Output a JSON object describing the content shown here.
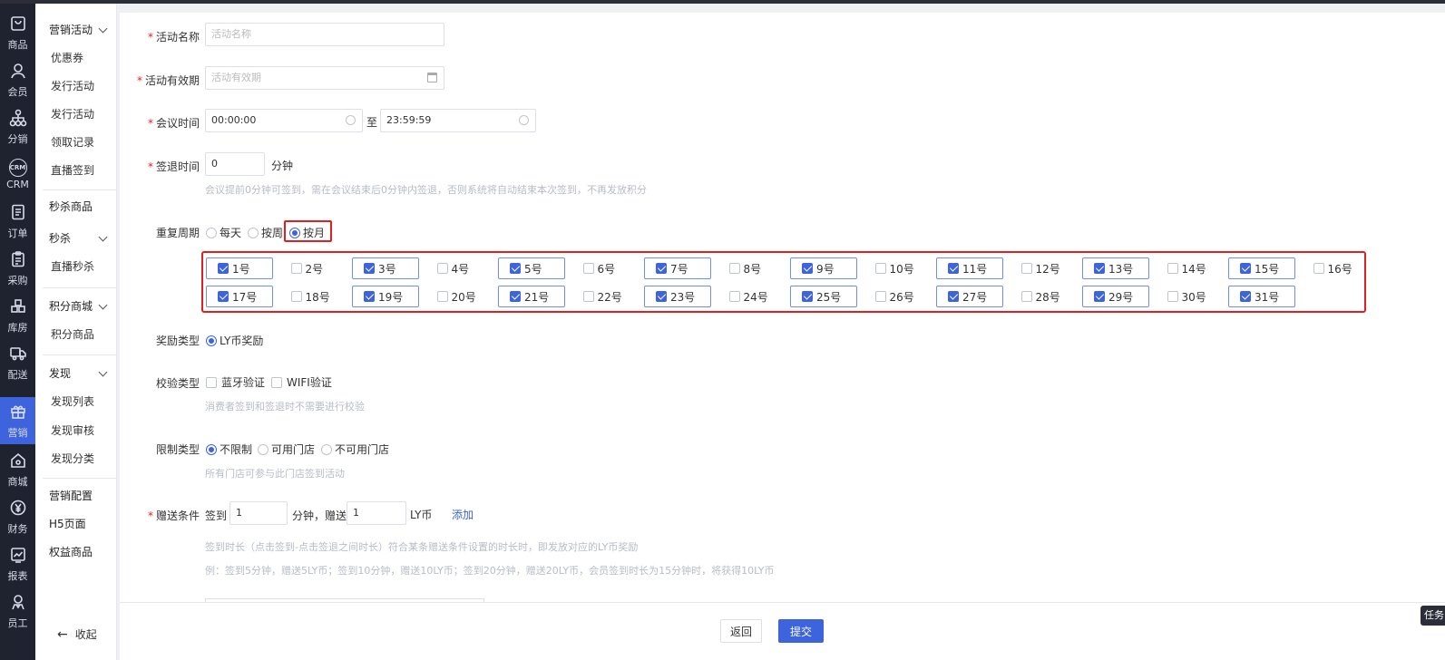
{
  "rail": [
    {
      "key": "goods",
      "label": "商品",
      "icon": "bag-icon"
    },
    {
      "key": "member",
      "label": "会员",
      "icon": "user-icon"
    },
    {
      "key": "distribution",
      "label": "分销",
      "icon": "network-icon"
    },
    {
      "key": "crm",
      "label": "CRM",
      "icon": "crm-icon"
    },
    {
      "key": "orders",
      "label": "订单",
      "icon": "document-icon"
    },
    {
      "key": "purchase",
      "label": "采购",
      "icon": "clipboard-icon"
    },
    {
      "key": "warehouse",
      "label": "库房",
      "icon": "boxes-icon"
    },
    {
      "key": "delivery",
      "label": "配送",
      "icon": "truck-icon"
    },
    {
      "key": "marketing",
      "label": "营销",
      "icon": "gift-icon"
    },
    {
      "key": "mall",
      "label": "商城",
      "icon": "home-icon"
    },
    {
      "key": "finance",
      "label": "财务",
      "icon": "yen-icon"
    },
    {
      "key": "reports",
      "label": "报表",
      "icon": "chart-icon"
    },
    {
      "key": "staff",
      "label": "员工",
      "icon": "staff-icon"
    }
  ],
  "submenu": {
    "g1": "营销活动",
    "coupon": "优惠券",
    "issue1": "发行活动",
    "issue2": "发行活动",
    "claim": "领取记录",
    "live_checkin": "直播签到",
    "flash_goods": "秒杀商品",
    "g2": "秒杀",
    "live_flash": "直播秒杀",
    "g3": "积分商城",
    "points_goods": "积分商品",
    "g4": "发现",
    "discover_list": "发现列表",
    "discover_review": "发现审核",
    "discover_cat": "发现分类",
    "marketing_config": "营销配置",
    "h5": "H5页面",
    "rights_goods": "权益商品",
    "collapse": "收起"
  },
  "form": {
    "required_mark": "*",
    "name_label": "活动名称",
    "name_placeholder": "活动名称",
    "validity_label": "活动有效期",
    "validity_placeholder": "活动有效期",
    "meeting_label": "会议时间",
    "meeting_start": "00:00:00",
    "meeting_to": "至",
    "meeting_end": "23:59:59",
    "signout_label": "签退时间",
    "signout_value": "0",
    "signout_unit": "分钟",
    "signout_hint": "会议提前0分钟可签到，需在会议结束后0分钟内签退，否则系统将自动结束本次签到，不再发放积分",
    "repeat_label": "重复周期",
    "repeat_options": [
      "每天",
      "按周",
      "按月"
    ],
    "repeat_selected": "按月",
    "days": [
      {
        "label": "1号",
        "checked": true
      },
      {
        "label": "2号",
        "checked": false
      },
      {
        "label": "3号",
        "checked": true
      },
      {
        "label": "4号",
        "checked": false
      },
      {
        "label": "5号",
        "checked": true
      },
      {
        "label": "6号",
        "checked": false
      },
      {
        "label": "7号",
        "checked": true
      },
      {
        "label": "8号",
        "checked": false
      },
      {
        "label": "9号",
        "checked": true
      },
      {
        "label": "10号",
        "checked": false
      },
      {
        "label": "11号",
        "checked": true
      },
      {
        "label": "12号",
        "checked": false
      },
      {
        "label": "13号",
        "checked": true
      },
      {
        "label": "14号",
        "checked": false
      },
      {
        "label": "15号",
        "checked": true
      },
      {
        "label": "16号",
        "checked": false
      },
      {
        "label": "17号",
        "checked": true
      },
      {
        "label": "18号",
        "checked": false
      },
      {
        "label": "19号",
        "checked": true
      },
      {
        "label": "20号",
        "checked": false
      },
      {
        "label": "21号",
        "checked": true
      },
      {
        "label": "22号",
        "checked": false
      },
      {
        "label": "23号",
        "checked": true
      },
      {
        "label": "24号",
        "checked": false
      },
      {
        "label": "25号",
        "checked": true
      },
      {
        "label": "26号",
        "checked": false
      },
      {
        "label": "27号",
        "checked": true
      },
      {
        "label": "28号",
        "checked": false
      },
      {
        "label": "29号",
        "checked": true
      },
      {
        "label": "30号",
        "checked": false
      },
      {
        "label": "31号",
        "checked": true
      }
    ],
    "reward_label": "奖励类型",
    "reward_option": "LY币奖励",
    "verify_label": "校验类型",
    "verify_bt": "蓝牙验证",
    "verify_wifi": "WIFI验证",
    "verify_hint": "消费者签到和签退时不需要进行校验",
    "limit_label": "限制类型",
    "limit_options": [
      "不限制",
      "可用门店",
      "不可用门店"
    ],
    "limit_hint": "所有门店可参与此门店签到活动",
    "gift_label": "赠送条件",
    "gift_prefix": "签到",
    "gift_minutes": "1",
    "gift_mid": "分钟，赠送",
    "gift_coins": "1",
    "gift_unit": "LY币",
    "gift_add": "添加",
    "gift_hint1": "签到时长（点击签到-点击签退之间时长）符合某条赠送条件设置的时长时，即发放对应的LY币奖励",
    "gift_hint2": "例：签到5分钟，赠送5LY币；签到10分钟，赠送10LY币；签到20分钟，赠送20LY币，会员签到时长为15分钟时，将获得10LY币"
  },
  "footer": {
    "back": "返回",
    "submit": "提交"
  },
  "task_tab": "任务",
  "colors": {
    "accent": "#3d63dd",
    "highlight": "#e02020",
    "rail_bg": "#1f2330"
  }
}
